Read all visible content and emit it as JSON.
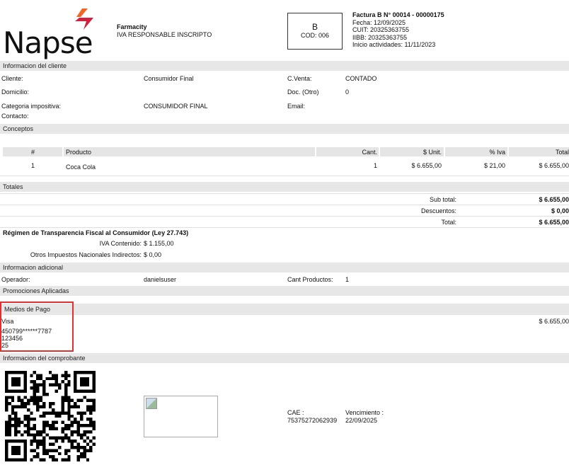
{
  "header": {
    "logo_text": "Napse",
    "company_name": "Farmacity",
    "tax_status": "IVA RESPONSABLE INSCRIPTO",
    "invoice_letter": "B",
    "cod": "COD: 006",
    "invoice_title": "Factura B N° 00014 - 00000175",
    "fecha": "Fecha: 12/09/2025",
    "cuit": "CUIT: 20325363755",
    "iibb": "IIBB: 20325363755",
    "inicio": "Inicio actividades: 11/11/2023"
  },
  "cliente": {
    "section_title": "Informacion del cliente",
    "cliente_label": "Cliente:",
    "cliente_value": "Consumidor Final",
    "cventa_label": "C.Venta:",
    "cventa_value": "CONTADO",
    "domicilio_label": "Domicilio:",
    "doc_label": "Doc. (Otro)",
    "doc_value": "0",
    "categoria_label": "Categoria impositiva:",
    "categoria_value": "CONSUMIDOR FINAL",
    "email_label": "Email:",
    "contacto_label": "Contacto:"
  },
  "conceptos": {
    "section_title": "Conceptos",
    "headers": {
      "num": "#",
      "producto": "Producto",
      "cant": "Cant.",
      "unit": "$ Unit.",
      "iva": "% Iva",
      "total": "Total"
    },
    "rows": [
      {
        "num": "1",
        "producto": "Coca Cola",
        "cant": "1",
        "unit": "$ 6.655,00",
        "iva": "$ 21,00",
        "total": "$ 6.655,00"
      }
    ]
  },
  "totales": {
    "section_title": "Totales",
    "subtotal_label": "Sub total:",
    "subtotal_value": "$ 6.655,00",
    "descuentos_label": "Descuentos:",
    "descuentos_value": "$ 0,00",
    "total_label": "Total:",
    "total_value": "$ 6.655,00"
  },
  "transparencia": {
    "title": "Régimen de Transparencia Fiscal al Consumidor (Ley 27.743)",
    "iva_label": "IVA Contenido:",
    "iva_value": "$ 1.155,00",
    "otros_label": "Otros Impuestos Nacionales Indirectos:",
    "otros_value": "$ 0,00"
  },
  "adicional": {
    "section_title": "Informacion adicional",
    "operador_label": "Operador:",
    "operador_value": "danielsuser",
    "cant_label": "Cant Productos:",
    "cant_value": "1"
  },
  "promociones": {
    "section_title": "Promociones Aplicadas"
  },
  "pago": {
    "section_title": "Medios de Pago",
    "method": "Visa",
    "card": "450799******7787",
    "auth": "123456",
    "cuotas": "25",
    "amount": "$ 6.655,00",
    "highlight_color": "#e03030"
  },
  "comprobante": {
    "section_title": "Informacion del comprobante",
    "cae_label": "CAE :",
    "cae_value": "75375272062939",
    "venc_label": "Vencimiento :",
    "venc_value": "22/09/2025"
  },
  "colors": {
    "band": "#e7e7e7",
    "logo_accent": "#f26522",
    "logo_accent2": "#d21f3c"
  }
}
